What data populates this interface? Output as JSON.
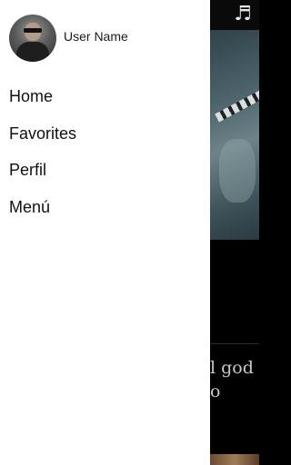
{
  "header": {
    "user_name": "User Name",
    "avatar_icon": "user-avatar-icon"
  },
  "menu": {
    "items": [
      {
        "label": "Home"
      },
      {
        "label": "Favorites"
      },
      {
        "label": "Perfil"
      },
      {
        "label": "Menú"
      }
    ]
  },
  "background": {
    "music_icon_glyph": "♬",
    "caption": "l god\no"
  }
}
